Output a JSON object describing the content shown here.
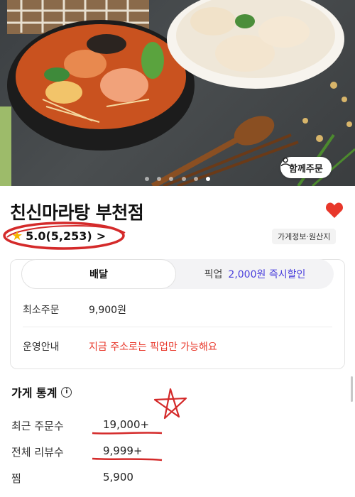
{
  "hero": {
    "carousel_dots": 6,
    "active_dot": 5,
    "together_order_label": "함께주문"
  },
  "store": {
    "name": "친신마라탕 부천점",
    "rating": "5.0",
    "review_count": "(5,253)",
    "info_chip": "가게정보·원산지",
    "favorited": true
  },
  "order_card": {
    "tab_delivery": "배달",
    "tab_pickup": "픽업",
    "pickup_promo": "2,000원 즉시할인",
    "min_order_label": "최소주문",
    "min_order_value": "9,900원",
    "ops_label": "운영안내",
    "ops_value": "지금 주소로는 픽업만 가능해요"
  },
  "stats": {
    "title": "가게 통계",
    "info_icon": "i",
    "rows": [
      {
        "label": "최근 주문수",
        "value": "19,000+"
      },
      {
        "label": "전체 리뷰수",
        "value": "9,999+"
      },
      {
        "label": "찜",
        "value": "5,900"
      }
    ]
  },
  "colors": {
    "accent_red": "#e8372a",
    "promo_purple": "#4a3fdc",
    "star_yellow": "#f5b800",
    "annotation_red": "#d42a2a"
  }
}
